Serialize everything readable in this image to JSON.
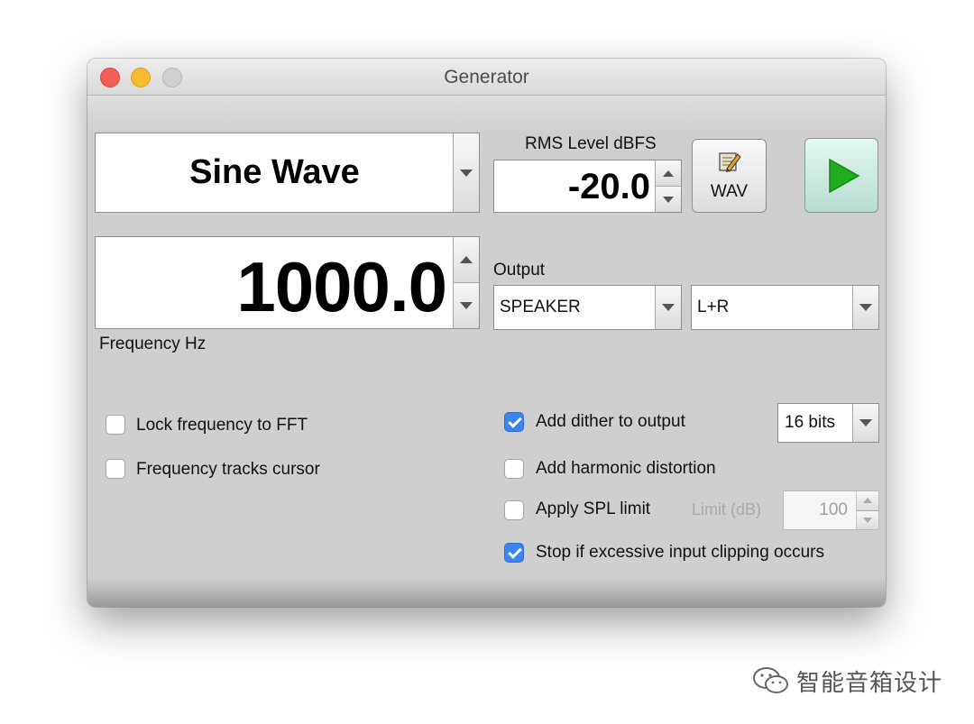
{
  "window": {
    "title": "Generator"
  },
  "waveform": {
    "value": "Sine Wave"
  },
  "frequency": {
    "value": "1000.0",
    "label": "Frequency Hz"
  },
  "rms": {
    "label": "RMS Level dBFS",
    "value": "-20.0"
  },
  "wav_button": {
    "label": "WAV",
    "icon": "pencil-edit-icon"
  },
  "play_button": {
    "icon": "play-icon",
    "color": "#1fae1f"
  },
  "output": {
    "label": "Output",
    "device": "SPEAKER",
    "channel": "L+R"
  },
  "options_left": [
    {
      "label": "Lock frequency to FFT",
      "checked": false
    },
    {
      "label": "Frequency tracks cursor",
      "checked": false
    }
  ],
  "options_right": {
    "dither": {
      "label": "Add dither to output",
      "checked": true,
      "bits": "16 bits"
    },
    "harmonic": {
      "label": "Add harmonic distortion",
      "checked": false
    },
    "spl": {
      "label": "Apply SPL limit",
      "checked": false,
      "limit_label": "Limit (dB)",
      "limit_value": "100"
    },
    "clip": {
      "label": "Stop if excessive input clipping occurs",
      "checked": true
    }
  },
  "watermark": {
    "text": "智能音箱设计",
    "icon": "wechat-icon"
  },
  "colors": {
    "checkbox_accent": "#3a84f0",
    "play_green": "#1fae1f",
    "window_bg": "#cfcfcf"
  }
}
